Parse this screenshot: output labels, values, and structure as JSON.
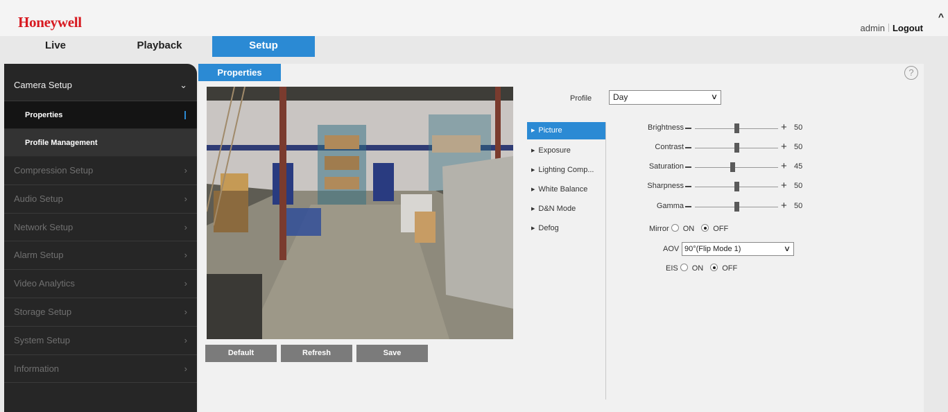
{
  "header": {
    "logo": "Honeywell",
    "user": "admin",
    "logout": "Logout"
  },
  "tabs": [
    {
      "label": "Live"
    },
    {
      "label": "Playback"
    },
    {
      "label": "Setup",
      "active": true
    }
  ],
  "sidebar": {
    "camera_setup": "Camera Setup",
    "properties": "Properties",
    "profile_management": "Profile Management",
    "items": [
      {
        "label": "Compression Setup"
      },
      {
        "label": "Audio Setup"
      },
      {
        "label": "Network Setup"
      },
      {
        "label": "Alarm Setup"
      },
      {
        "label": "Video Analytics"
      },
      {
        "label": "Storage Setup"
      },
      {
        "label": "System Setup"
      },
      {
        "label": "Information"
      }
    ]
  },
  "content": {
    "tab": "Properties",
    "help": "?",
    "profile_label": "Profile",
    "profile_value": "Day",
    "buttons": {
      "default": "Default",
      "refresh": "Refresh",
      "save": "Save"
    },
    "submenu": [
      {
        "label": "Picture",
        "active": true
      },
      {
        "label": "Exposure"
      },
      {
        "label": "Lighting Comp..."
      },
      {
        "label": "White Balance"
      },
      {
        "label": "D&N Mode"
      },
      {
        "label": "Defog"
      }
    ],
    "sliders": [
      {
        "label": "Brightness",
        "value": "50",
        "level": 0.5
      },
      {
        "label": "Contrast",
        "value": "50",
        "level": 0.5
      },
      {
        "label": "Saturation",
        "value": "45",
        "level": 0.45
      },
      {
        "label": "Sharpness",
        "value": "50",
        "level": 0.5
      },
      {
        "label": "Gamma",
        "value": "50",
        "level": 0.5
      }
    ],
    "mirror": {
      "label": "Mirror",
      "on": "ON",
      "off": "OFF",
      "selected": "OFF"
    },
    "aov": {
      "label": "AOV",
      "value": "90°(Flip Mode 1)"
    },
    "eis": {
      "label": "EIS",
      "on": "ON",
      "off": "OFF",
      "selected": "OFF"
    }
  },
  "colors": {
    "accent": "#2b8ad4",
    "brand": "#d71920",
    "sidebar": "#262626"
  }
}
